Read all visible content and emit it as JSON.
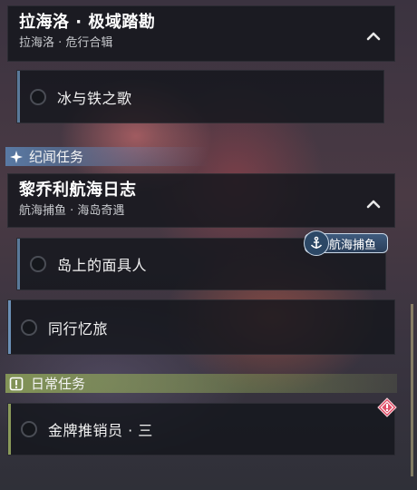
{
  "groups": [
    {
      "title": "拉海洛 · 极域踏勘",
      "subtitle": "拉海洛 · 危行合辑",
      "quests": [
        {
          "label": "冰与铁之歌"
        }
      ]
    },
    {
      "title": "黎乔利航海日志",
      "subtitle": "航海捕鱼 · 海岛奇遇",
      "quests": [
        {
          "label": "岛上的面具人",
          "badge": "航海捕鱼"
        },
        {
          "label": "同行忆旅"
        }
      ]
    }
  ],
  "sections": {
    "story": {
      "label": "纪闻任务",
      "color": "#5f8fc4",
      "icon": "sparkle-icon"
    },
    "daily": {
      "label": "日常任务",
      "color": "#8ea35a",
      "icon": "exclamation-box-icon"
    }
  },
  "daily_quests": [
    {
      "label": "金牌推销员 · 三",
      "alert_icon": "warning-diamond-icon",
      "alert_color": "#e0506a"
    }
  ],
  "accent_colors": {
    "story": "#6b8fb5",
    "daily": "#8a9a5a"
  }
}
